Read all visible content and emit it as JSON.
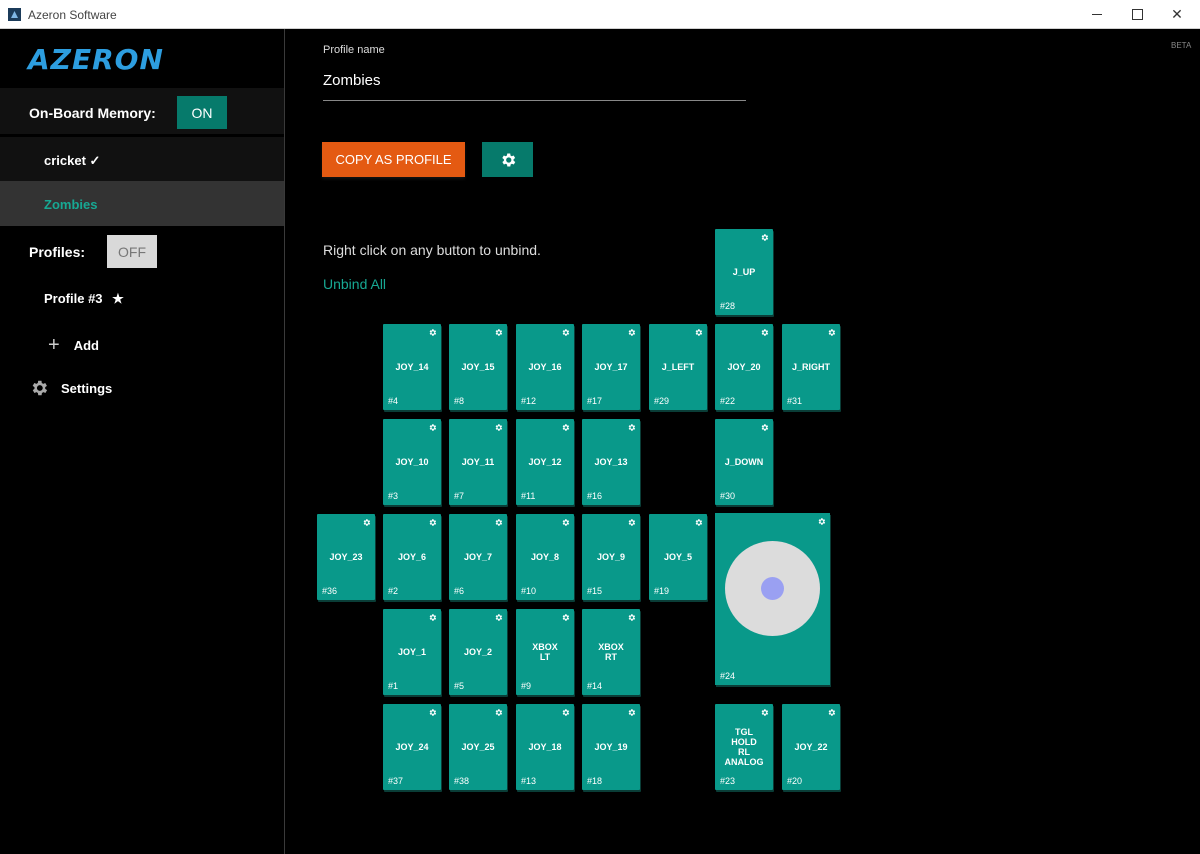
{
  "window": {
    "title": "Azeron Software"
  },
  "sidebar": {
    "logo": "AZERON",
    "onboard_label": "On-Board Memory:",
    "onboard_toggle": "ON",
    "memory_items": [
      {
        "label": "cricket",
        "mark": "✓"
      },
      {
        "label": "Zombies"
      }
    ],
    "profiles_label": "Profiles:",
    "profiles_toggle": "OFF",
    "profile_items": [
      {
        "label": "Profile #3",
        "mark": "★"
      }
    ],
    "add_label": "Add",
    "settings_label": "Settings"
  },
  "main": {
    "beta": "BETA",
    "profile_name_label": "Profile name",
    "profile_name_value": "Zombies",
    "copy_button": "COPY AS PROFILE",
    "hint": "Right click on any button to unbind.",
    "unbind_all": "Unbind All"
  },
  "keys": [
    {
      "label": "J_UP",
      "num": "#28"
    },
    {
      "label": "JOY_14",
      "num": "#4"
    },
    {
      "label": "JOY_15",
      "num": "#8"
    },
    {
      "label": "JOY_16",
      "num": "#12"
    },
    {
      "label": "JOY_17",
      "num": "#17"
    },
    {
      "label": "J_LEFT",
      "num": "#29"
    },
    {
      "label": "JOY_20",
      "num": "#22"
    },
    {
      "label": "J_RIGHT",
      "num": "#31"
    },
    {
      "label": "JOY_10",
      "num": "#3"
    },
    {
      "label": "JOY_11",
      "num": "#7"
    },
    {
      "label": "JOY_12",
      "num": "#11"
    },
    {
      "label": "JOY_13",
      "num": "#16"
    },
    {
      "label": "J_DOWN",
      "num": "#30"
    },
    {
      "label": "JOY_23",
      "num": "#36"
    },
    {
      "label": "JOY_6",
      "num": "#2"
    },
    {
      "label": "JOY_7",
      "num": "#6"
    },
    {
      "label": "JOY_8",
      "num": "#10"
    },
    {
      "label": "JOY_9",
      "num": "#15"
    },
    {
      "label": "JOY_5",
      "num": "#19"
    },
    {
      "label": "JOY_1",
      "num": "#1"
    },
    {
      "label": "JOY_2",
      "num": "#5"
    },
    {
      "label": "XBOX\nLT",
      "num": "#9"
    },
    {
      "label": "XBOX\nRT",
      "num": "#14"
    },
    {
      "label": "JOY_24",
      "num": "#37"
    },
    {
      "label": "JOY_25",
      "num": "#38"
    },
    {
      "label": "JOY_18",
      "num": "#13"
    },
    {
      "label": "JOY_19",
      "num": "#18"
    },
    {
      "label": "TGL\nHOLD\nRL\nANALOG",
      "num": "#23"
    },
    {
      "label": "JOY_22",
      "num": "#20"
    }
  ],
  "joystick": {
    "num": "#24"
  }
}
